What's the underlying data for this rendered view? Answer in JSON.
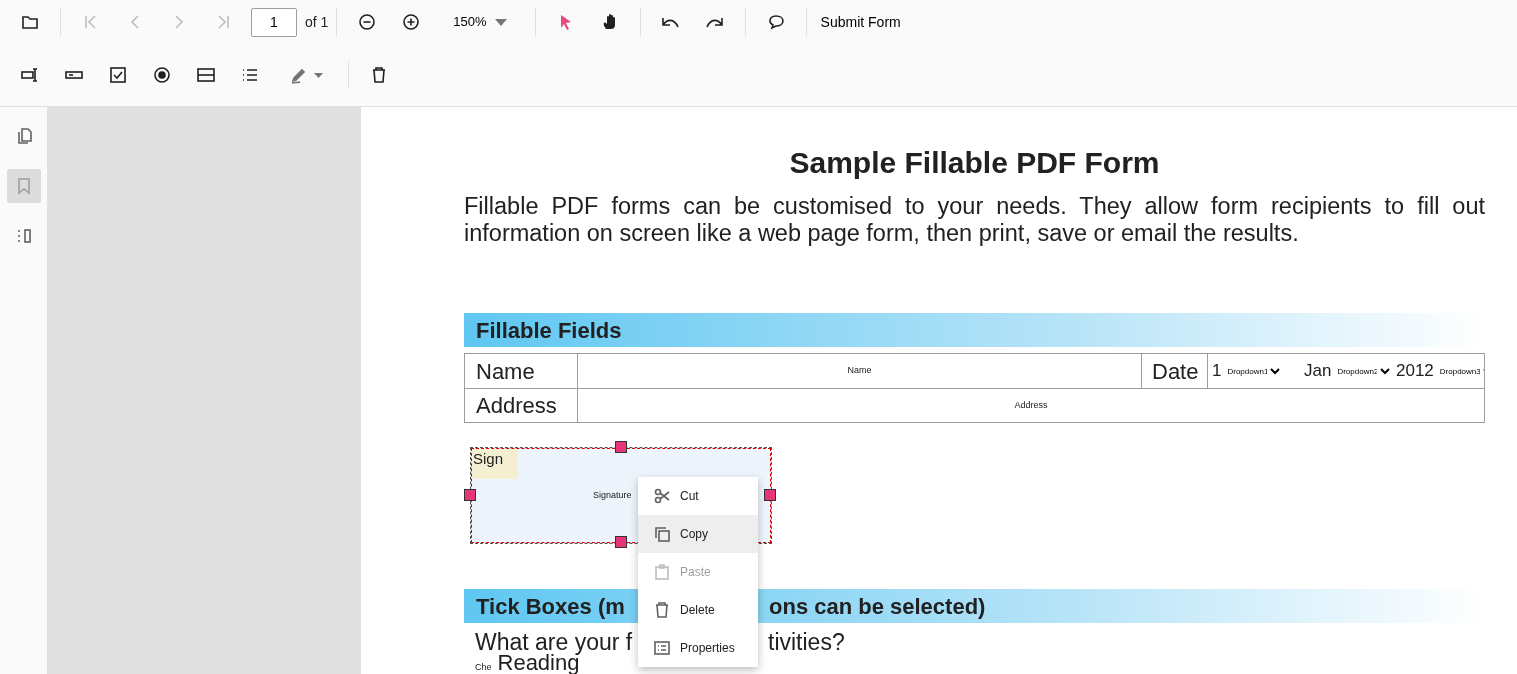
{
  "toolbar": {
    "navigation": [
      {
        "disabled": true
      },
      {
        "disabled": true
      },
      {
        "disabled": true
      },
      {
        "disabled": true
      }
    ],
    "page_number": "1",
    "page_count": "of 1",
    "zoom": "150%",
    "tools": [
      {
        "selected": true
      },
      {
        "selected": false
      }
    ],
    "submit_button": "Submit Form"
  },
  "sidebar": {
    "items": [
      {
        "selected": false
      },
      {
        "selected": true
      },
      {
        "selected": false
      }
    ]
  },
  "document": {
    "title": "Sample Fillable PDF Form",
    "intro": "Fillable PDF forms can be customised to your needs. They allow form recipients to fill out information on screen like a web page form, then print, save or email the results.",
    "section_1": "Fillable Fields",
    "name_label": "Name",
    "name_field": "Name",
    "date_label": "Date",
    "date_parts": [
      {
        "value": "1",
        "dropdown": "Dropdown1"
      },
      {
        "value": "Jan",
        "dropdown": "Dropdown2"
      },
      {
        "value": "2012",
        "dropdown": "Dropdown3"
      }
    ],
    "address_label": "Address",
    "address_field": "Address",
    "signature": {
      "label": "Sign",
      "field": "Signature",
      "selected": true
    },
    "section_2": [
      "Tick Boxes (m",
      "ons can be selected)"
    ],
    "question": [
      "What are your f",
      "tivities?"
    ],
    "checkbox_label": "Che",
    "option": "Reading"
  },
  "context_menu": [
    {
      "label": "Cut",
      "disabled": false,
      "selected": false
    },
    {
      "label": "Copy",
      "disabled": false,
      "selected": true
    },
    {
      "label": "Paste",
      "disabled": true,
      "selected": false
    },
    {
      "label": "Delete",
      "disabled": false,
      "selected": false
    },
    {
      "label": "Properties",
      "disabled": false,
      "selected": false
    }
  ]
}
